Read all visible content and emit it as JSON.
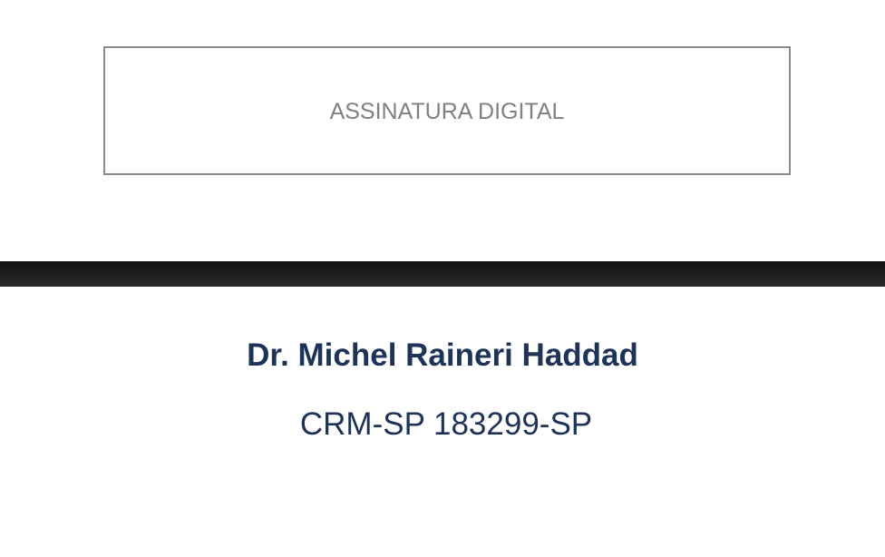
{
  "signature": {
    "label": "ASSINATURA DIGITAL"
  },
  "doctor": {
    "name": "Dr. Michel Raineri Haddad",
    "crm": "CRM-SP 183299-SP"
  },
  "colors": {
    "name_text": "#1e3358",
    "signature_label": "#808080",
    "signature_border": "#8a8a8a",
    "divider": "#1a1a1a"
  }
}
